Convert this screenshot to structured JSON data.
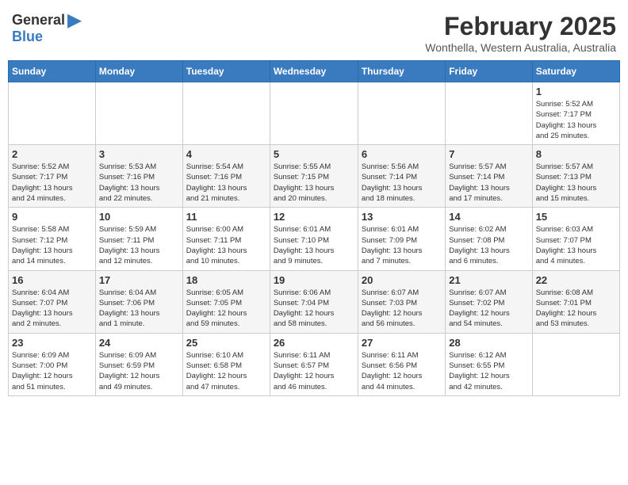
{
  "header": {
    "logo_general": "General",
    "logo_blue": "Blue",
    "month": "February 2025",
    "location": "Wonthella, Western Australia, Australia"
  },
  "weekdays": [
    "Sunday",
    "Monday",
    "Tuesday",
    "Wednesday",
    "Thursday",
    "Friday",
    "Saturday"
  ],
  "weeks": [
    [
      {
        "day": "",
        "info": ""
      },
      {
        "day": "",
        "info": ""
      },
      {
        "day": "",
        "info": ""
      },
      {
        "day": "",
        "info": ""
      },
      {
        "day": "",
        "info": ""
      },
      {
        "day": "",
        "info": ""
      },
      {
        "day": "1",
        "info": "Sunrise: 5:52 AM\nSunset: 7:17 PM\nDaylight: 13 hours\nand 25 minutes."
      }
    ],
    [
      {
        "day": "2",
        "info": "Sunrise: 5:52 AM\nSunset: 7:17 PM\nDaylight: 13 hours\nand 24 minutes."
      },
      {
        "day": "3",
        "info": "Sunrise: 5:53 AM\nSunset: 7:16 PM\nDaylight: 13 hours\nand 22 minutes."
      },
      {
        "day": "4",
        "info": "Sunrise: 5:54 AM\nSunset: 7:16 PM\nDaylight: 13 hours\nand 21 minutes."
      },
      {
        "day": "5",
        "info": "Sunrise: 5:55 AM\nSunset: 7:15 PM\nDaylight: 13 hours\nand 20 minutes."
      },
      {
        "day": "6",
        "info": "Sunrise: 5:56 AM\nSunset: 7:14 PM\nDaylight: 13 hours\nand 18 minutes."
      },
      {
        "day": "7",
        "info": "Sunrise: 5:57 AM\nSunset: 7:14 PM\nDaylight: 13 hours\nand 17 minutes."
      },
      {
        "day": "8",
        "info": "Sunrise: 5:57 AM\nSunset: 7:13 PM\nDaylight: 13 hours\nand 15 minutes."
      }
    ],
    [
      {
        "day": "9",
        "info": "Sunrise: 5:58 AM\nSunset: 7:12 PM\nDaylight: 13 hours\nand 14 minutes."
      },
      {
        "day": "10",
        "info": "Sunrise: 5:59 AM\nSunset: 7:11 PM\nDaylight: 13 hours\nand 12 minutes."
      },
      {
        "day": "11",
        "info": "Sunrise: 6:00 AM\nSunset: 7:11 PM\nDaylight: 13 hours\nand 10 minutes."
      },
      {
        "day": "12",
        "info": "Sunrise: 6:01 AM\nSunset: 7:10 PM\nDaylight: 13 hours\nand 9 minutes."
      },
      {
        "day": "13",
        "info": "Sunrise: 6:01 AM\nSunset: 7:09 PM\nDaylight: 13 hours\nand 7 minutes."
      },
      {
        "day": "14",
        "info": "Sunrise: 6:02 AM\nSunset: 7:08 PM\nDaylight: 13 hours\nand 6 minutes."
      },
      {
        "day": "15",
        "info": "Sunrise: 6:03 AM\nSunset: 7:07 PM\nDaylight: 13 hours\nand 4 minutes."
      }
    ],
    [
      {
        "day": "16",
        "info": "Sunrise: 6:04 AM\nSunset: 7:07 PM\nDaylight: 13 hours\nand 2 minutes."
      },
      {
        "day": "17",
        "info": "Sunrise: 6:04 AM\nSunset: 7:06 PM\nDaylight: 13 hours\nand 1 minute."
      },
      {
        "day": "18",
        "info": "Sunrise: 6:05 AM\nSunset: 7:05 PM\nDaylight: 12 hours\nand 59 minutes."
      },
      {
        "day": "19",
        "info": "Sunrise: 6:06 AM\nSunset: 7:04 PM\nDaylight: 12 hours\nand 58 minutes."
      },
      {
        "day": "20",
        "info": "Sunrise: 6:07 AM\nSunset: 7:03 PM\nDaylight: 12 hours\nand 56 minutes."
      },
      {
        "day": "21",
        "info": "Sunrise: 6:07 AM\nSunset: 7:02 PM\nDaylight: 12 hours\nand 54 minutes."
      },
      {
        "day": "22",
        "info": "Sunrise: 6:08 AM\nSunset: 7:01 PM\nDaylight: 12 hours\nand 53 minutes."
      }
    ],
    [
      {
        "day": "23",
        "info": "Sunrise: 6:09 AM\nSunset: 7:00 PM\nDaylight: 12 hours\nand 51 minutes."
      },
      {
        "day": "24",
        "info": "Sunrise: 6:09 AM\nSunset: 6:59 PM\nDaylight: 12 hours\nand 49 minutes."
      },
      {
        "day": "25",
        "info": "Sunrise: 6:10 AM\nSunset: 6:58 PM\nDaylight: 12 hours\nand 47 minutes."
      },
      {
        "day": "26",
        "info": "Sunrise: 6:11 AM\nSunset: 6:57 PM\nDaylight: 12 hours\nand 46 minutes."
      },
      {
        "day": "27",
        "info": "Sunrise: 6:11 AM\nSunset: 6:56 PM\nDaylight: 12 hours\nand 44 minutes."
      },
      {
        "day": "28",
        "info": "Sunrise: 6:12 AM\nSunset: 6:55 PM\nDaylight: 12 hours\nand 42 minutes."
      },
      {
        "day": "",
        "info": ""
      }
    ]
  ]
}
